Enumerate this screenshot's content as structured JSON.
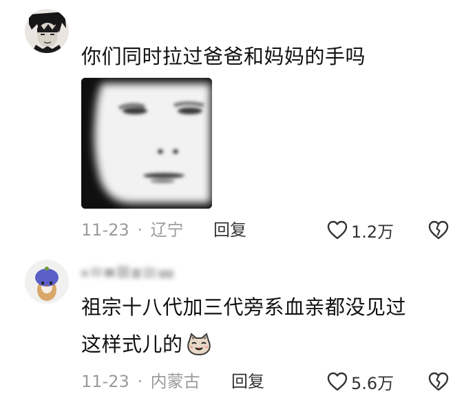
{
  "comments": [
    {
      "text": "你们同时拉过爸爸和妈妈的手吗",
      "date": "11-23",
      "location": "辽宁",
      "reply_label": "回复",
      "likes": "1.2万"
    },
    {
      "text_line1": "祖宗十八代加三代旁系血亲都没见过",
      "text_line2": "这样式儿的",
      "date": "11-23",
      "location": "内蒙古",
      "reply_label": "回复",
      "likes": "5.6万"
    }
  ],
  "separator": "·",
  "icons": {
    "like": "heart-outline-icon",
    "dislike": "broken-heart-icon",
    "emoji": "cat-face-emoji-icon"
  }
}
